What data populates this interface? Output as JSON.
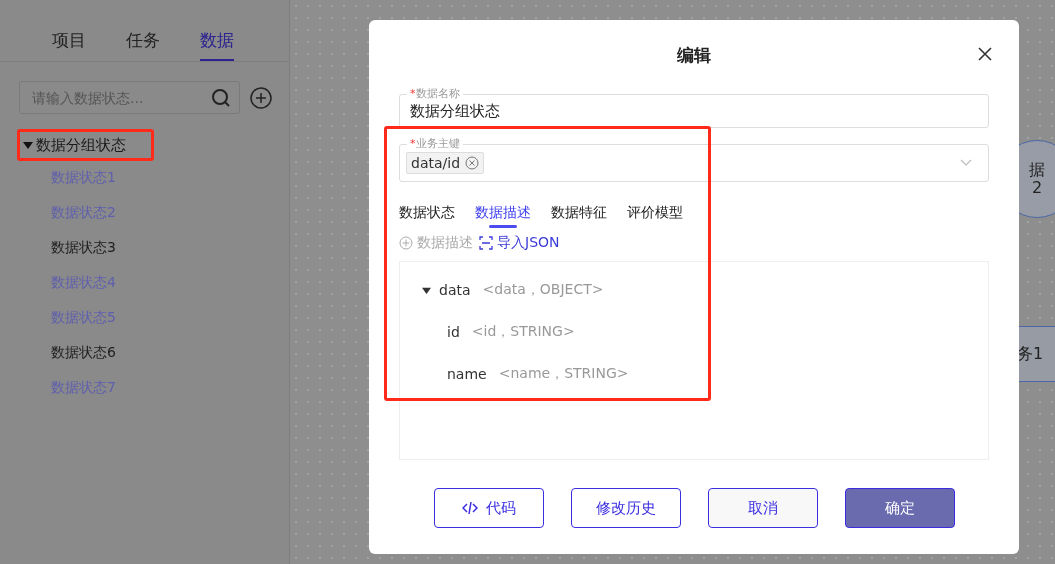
{
  "sidebar": {
    "tabs": [
      {
        "label": "项目",
        "selected": false
      },
      {
        "label": "任务",
        "selected": false
      },
      {
        "label": "数据",
        "selected": true
      }
    ],
    "search": {
      "placeholder": "请输入数据状态..."
    },
    "tree": {
      "label": "数据分组状态",
      "expanded": true,
      "children": [
        {
          "label": "数据状态1",
          "color": "#5f5fae"
        },
        {
          "label": "数据状态2",
          "color": "#5f5fae"
        },
        {
          "label": "数据状态3",
          "color": "#1e1e1e"
        },
        {
          "label": "数据状态4",
          "color": "#5f5fae"
        },
        {
          "label": "数据状态5",
          "color": "#5f5fae"
        },
        {
          "label": "数据状态6",
          "color": "#1e1e1e"
        },
        {
          "label": "数据状态7",
          "color": "#5f5fae"
        }
      ]
    }
  },
  "canvas": {
    "nodes": [
      {
        "kind": "circle",
        "lines": [
          "据",
          "2"
        ]
      },
      {
        "kind": "rect",
        "lines": [
          "务1"
        ]
      }
    ]
  },
  "dialog": {
    "title": "编辑",
    "name_field": {
      "required_mark": "*",
      "label": "数据名称",
      "value": "数据分组状态"
    },
    "key_field": {
      "required_mark": "*",
      "label": "业务主键",
      "tags": [
        "data/id"
      ]
    },
    "tabs": [
      {
        "label": "数据状态",
        "selected": false
      },
      {
        "label": "数据描述",
        "selected": true
      },
      {
        "label": "数据特征",
        "selected": false
      },
      {
        "label": "评价模型",
        "selected": false
      }
    ],
    "actions": [
      {
        "kind": "add",
        "label": "数据描述",
        "disabled": true
      },
      {
        "kind": "import",
        "label": "导入JSON",
        "disabled": false
      }
    ],
    "schema": [
      {
        "name": "data",
        "type": "<data，OBJECT>",
        "expanded": true,
        "children": [
          {
            "name": "id",
            "type": "<id，STRING>"
          },
          {
            "name": "name",
            "type": "<name，STRING>"
          }
        ]
      }
    ],
    "buttons": [
      {
        "kind": "code",
        "label": "代码"
      },
      {
        "kind": "outline",
        "label": "修改历史"
      },
      {
        "kind": "cancel",
        "label": "取消"
      },
      {
        "kind": "primary",
        "label": "确定"
      }
    ]
  }
}
